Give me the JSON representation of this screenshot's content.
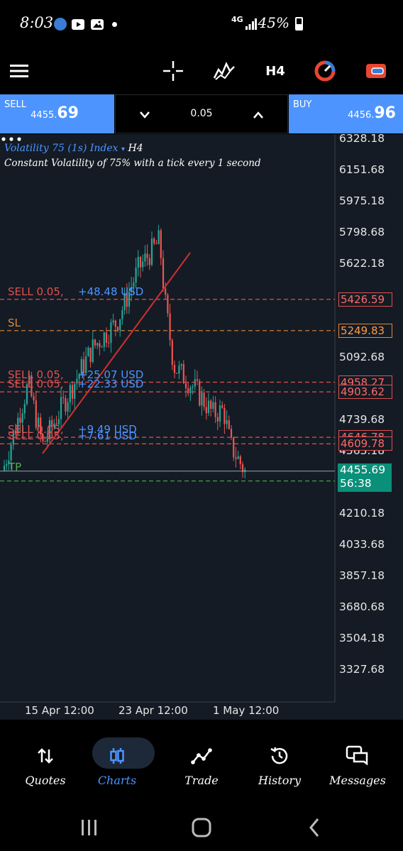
{
  "status_bar": {
    "time": "8:03",
    "network": "4G",
    "battery": "45%"
  },
  "toolbar": {
    "timeframe": "H4",
    "icons": [
      "menu-icon",
      "crosshair-icon",
      "indicators-icon",
      "timeframe",
      "pie-icon",
      "account-icon"
    ]
  },
  "trade_panel": {
    "sell_label": "SELL",
    "sell_price_main": "4455.",
    "sell_price_big": "69",
    "buy_label": "BUY",
    "buy_price_main": "4456.",
    "buy_price_big": "96",
    "lot_size": "0.05"
  },
  "chart": {
    "symbol": "Volatility 75 (1s) Index",
    "symbol_timeframe": "H4",
    "description": "Constant Volatility of 75% with a tick every 1 second",
    "y_ticks": [
      "6328.18",
      "6151.68",
      "5975.18",
      "5798.68",
      "5622.18",
      "5092.68",
      "4739.68",
      "4563.18",
      "4210.18",
      "4033.68",
      "3857.18",
      "3680.68",
      "3504.18",
      "3327.68"
    ],
    "x_ticks": [
      "15 Apr 12:00",
      "23 Apr 12:00",
      "1 May 12:00"
    ],
    "order_lines": [
      {
        "label": "SELL 0.05,",
        "profit": "+48.48 USD",
        "price": "5426.59",
        "color": "#e05050"
      },
      {
        "label": "SL",
        "profit": "",
        "price": "5249.83",
        "color": "#e0883a"
      },
      {
        "label": "SELL 0.05,",
        "profit": "+25.07 USD",
        "price": "4958.27",
        "color": "#e05050"
      },
      {
        "label": "SELL 0.05,",
        "profit": "+22.33 USD",
        "price": "4903.62",
        "color": "#e05050"
      },
      {
        "label": "SELL 0.05,",
        "profit": "+9.49 USD",
        "price": "4646.78",
        "color": "#e05050"
      },
      {
        "label": "SELL 0.05,",
        "profit": "+7.61 USD",
        "price": "4609.78",
        "color": "#e05050"
      }
    ],
    "tp_label": "TP",
    "current_price": "4455.69",
    "countdown": "56:38",
    "colors": {
      "bull": "#26a69a",
      "bear": "#ef5350",
      "background": "#141b24",
      "accent": "#4d94ff"
    }
  },
  "bottom_nav": {
    "items": [
      {
        "label": "Quotes",
        "icon": "quotes-icon"
      },
      {
        "label": "Charts",
        "icon": "charts-icon",
        "active": true
      },
      {
        "label": "Trade",
        "icon": "trade-icon"
      },
      {
        "label": "History",
        "icon": "history-icon"
      },
      {
        "label": "Messages",
        "icon": "messages-icon"
      }
    ]
  }
}
